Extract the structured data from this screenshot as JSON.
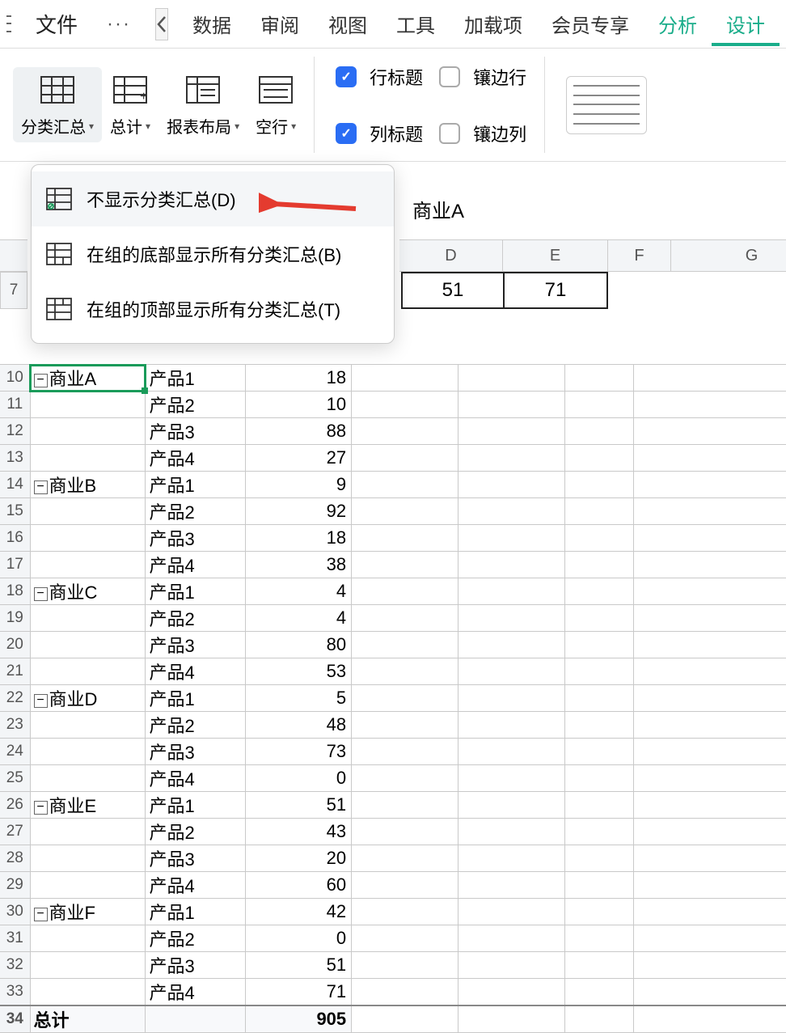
{
  "menu": {
    "file": "文件",
    "tabs": [
      "数据",
      "审阅",
      "视图",
      "工具",
      "加载项",
      "会员专享"
    ],
    "analysis": "分析",
    "design": "设计"
  },
  "ribbon": {
    "subtotal": "分类汇总",
    "grand_total": "总计",
    "layout": "报表布局",
    "blank_rows": "空行",
    "row_headers": "行标题",
    "col_headers": "列标题",
    "banded_rows": "镶边行",
    "banded_cols": "镶边列"
  },
  "dropdown": {
    "opt1": "不显示分类汇总(D)",
    "opt2": "在组的底部显示所有分类汇总(B)",
    "opt3": "在组的顶部显示所有分类汇总(T)"
  },
  "formula_value": "商业A",
  "columns": {
    "D": "D",
    "E": "E",
    "F": "F",
    "G": "G"
  },
  "floating_cells": {
    "D": "51",
    "E": "71"
  },
  "pivot": {
    "header_hint_left": "",
    "header_hint_mid": "",
    "header_hint_right": "",
    "rows": [
      {
        "rn": "7"
      },
      {
        "rn": "10",
        "cat": "商业A",
        "prod": "产品1",
        "val": "18",
        "selected": true,
        "collapse": true
      },
      {
        "rn": "11",
        "cat": "",
        "prod": "产品2",
        "val": "10"
      },
      {
        "rn": "12",
        "cat": "",
        "prod": "产品3",
        "val": "88"
      },
      {
        "rn": "13",
        "cat": "",
        "prod": "产品4",
        "val": "27"
      },
      {
        "rn": "14",
        "cat": "商业B",
        "prod": "产品1",
        "val": "9",
        "collapse": true
      },
      {
        "rn": "15",
        "cat": "",
        "prod": "产品2",
        "val": "92"
      },
      {
        "rn": "16",
        "cat": "",
        "prod": "产品3",
        "val": "18"
      },
      {
        "rn": "17",
        "cat": "",
        "prod": "产品4",
        "val": "38"
      },
      {
        "rn": "18",
        "cat": "商业C",
        "prod": "产品1",
        "val": "4",
        "collapse": true
      },
      {
        "rn": "19",
        "cat": "",
        "prod": "产品2",
        "val": "4"
      },
      {
        "rn": "20",
        "cat": "",
        "prod": "产品3",
        "val": "80"
      },
      {
        "rn": "21",
        "cat": "",
        "prod": "产品4",
        "val": "53"
      },
      {
        "rn": "22",
        "cat": "商业D",
        "prod": "产品1",
        "val": "5",
        "collapse": true
      },
      {
        "rn": "23",
        "cat": "",
        "prod": "产品2",
        "val": "48"
      },
      {
        "rn": "24",
        "cat": "",
        "prod": "产品3",
        "val": "73"
      },
      {
        "rn": "25",
        "cat": "",
        "prod": "产品4",
        "val": "0"
      },
      {
        "rn": "26",
        "cat": "商业E",
        "prod": "产品1",
        "val": "51",
        "collapse": true
      },
      {
        "rn": "27",
        "cat": "",
        "prod": "产品2",
        "val": "43"
      },
      {
        "rn": "28",
        "cat": "",
        "prod": "产品3",
        "val": "20"
      },
      {
        "rn": "29",
        "cat": "",
        "prod": "产品4",
        "val": "60"
      },
      {
        "rn": "30",
        "cat": "商业F",
        "prod": "产品1",
        "val": "42",
        "collapse": true
      },
      {
        "rn": "31",
        "cat": "",
        "prod": "产品2",
        "val": "0"
      },
      {
        "rn": "32",
        "cat": "",
        "prod": "产品3",
        "val": "51"
      },
      {
        "rn": "33",
        "cat": "",
        "prod": "产品4",
        "val": "71"
      }
    ],
    "total": {
      "rn": "34",
      "label": "总计",
      "val": "905"
    }
  }
}
